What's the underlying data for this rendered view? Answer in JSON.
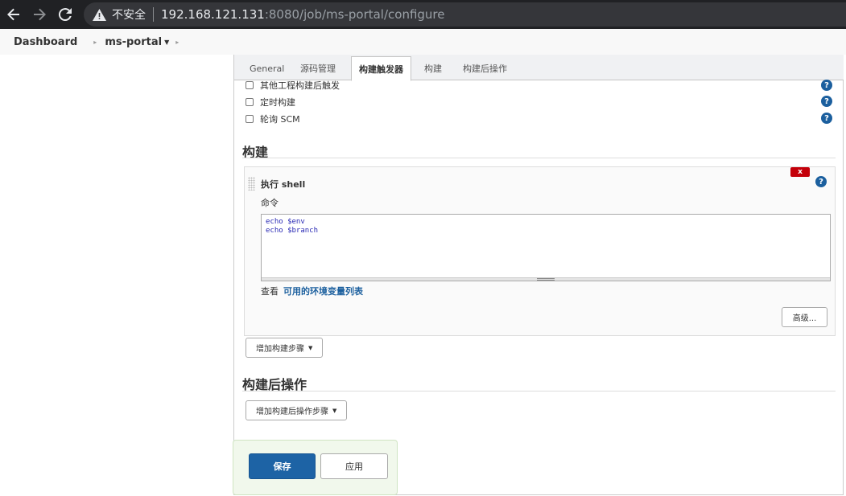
{
  "browser": {
    "insecure_label": "不安全",
    "url_host": "192.168.121.131",
    "url_rest": ":8080/job/ms-portal/configure"
  },
  "breadcrumb": {
    "dashboard": "Dashboard",
    "job": "ms-portal"
  },
  "tabs": [
    {
      "label": "General"
    },
    {
      "label": "源码管理"
    },
    {
      "label": "构建触发器"
    },
    {
      "label": "构建"
    },
    {
      "label": "构建后操作"
    }
  ],
  "triggers": [
    {
      "label": "其他工程构建后触发",
      "checked": false
    },
    {
      "label": "定时构建",
      "checked": false
    },
    {
      "label": "轮询 SCM",
      "checked": false
    }
  ],
  "build": {
    "section_title": "构建",
    "step_title": "执行 shell",
    "delete_label": "x",
    "command_label": "命令",
    "command_text": "echo $env\necho $branch",
    "env_prefix": "查看",
    "env_link": "可用的环境变量列表",
    "advanced_label": "高级...",
    "add_step_label": "增加构建步骤"
  },
  "post_build": {
    "section_title": "构建后操作",
    "add_step_label": "增加构建后操作步骤"
  },
  "actions": {
    "save": "保存",
    "apply": "应用"
  },
  "icons": {
    "help": "?"
  },
  "colors": {
    "primary": "#1d63a5",
    "link": "#1b5f9e",
    "danger": "#c4000a"
  }
}
